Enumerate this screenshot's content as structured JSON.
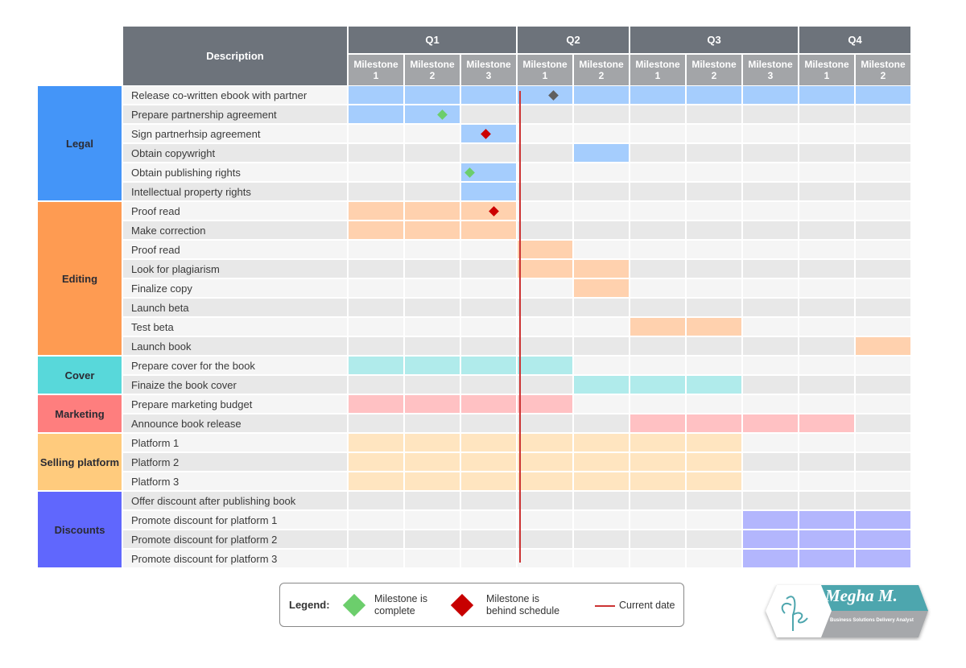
{
  "header": {
    "description_label": "Description",
    "quarters": [
      {
        "label": "Q1",
        "milestones": [
          "Milestone\n1",
          "Milestone\n2",
          "Milestone\n3"
        ]
      },
      {
        "label": "Q2",
        "milestones": [
          "Milestone\n1",
          "Milestone\n2"
        ]
      },
      {
        "label": "Q3",
        "milestones": [
          "Milestone\n1",
          "Milestone\n2",
          "Milestone\n3"
        ]
      },
      {
        "label": "Q4",
        "milestones": [
          "Milestone\n1",
          "Milestone\n2"
        ]
      }
    ]
  },
  "colors": {
    "row_light": "#f5f5f5",
    "row_dark": "#e8e8e8",
    "milestone_complete": "#6cce6c",
    "milestone_behind": "#cc0000",
    "milestone_neutral": "#5f5f5f",
    "current_date_line": "#cc3333"
  },
  "chart_data": {
    "type": "gantt",
    "title": "",
    "columns": [
      "Q1 Milestone 1",
      "Q1 Milestone 2",
      "Q1 Milestone 3",
      "Q2 Milestone 1",
      "Q2 Milestone 2",
      "Q3 Milestone 1",
      "Q3 Milestone 2",
      "Q3 Milestone 3",
      "Q4 Milestone 1",
      "Q4 Milestone 2"
    ],
    "current_date_column_fraction": 3.12,
    "categories": [
      {
        "name": "Legal",
        "color": "#4495f8",
        "bar_color": "#a5cdfd",
        "tasks": [
          {
            "name": "Release co-written ebook with partner",
            "start": 0,
            "end": 10,
            "milestone": {
              "column": 3,
              "position": 0.65,
              "status": "neutral"
            }
          },
          {
            "name": "Prepare partnership agreement",
            "start": 0,
            "end": 2,
            "milestone": {
              "column": 1,
              "position": 0.68,
              "status": "complete"
            }
          },
          {
            "name": "Sign partnerhsip agreement",
            "start": 2,
            "end": 3,
            "milestone": {
              "column": 2,
              "position": 0.45,
              "status": "behind"
            }
          },
          {
            "name": "Obtain copywright",
            "start": 4,
            "end": 5,
            "milestone": null
          },
          {
            "name": "Obtain publishing rights",
            "start": 2,
            "end": 3,
            "milestone": {
              "column": 2,
              "position": 0.15,
              "status": "complete"
            }
          },
          {
            "name": "Intellectual property rights",
            "start": 2,
            "end": 3,
            "milestone": null
          }
        ]
      },
      {
        "name": "Editing",
        "color": "#fe9b52",
        "bar_color": "#ffd1ae",
        "tasks": [
          {
            "name": "Proof read",
            "start": 0,
            "end": 3,
            "milestone": {
              "column": 2,
              "position": 0.6,
              "status": "behind"
            }
          },
          {
            "name": "Make correction",
            "start": 0,
            "end": 3,
            "milestone": null
          },
          {
            "name": "Proof read",
            "start": 3,
            "end": 4,
            "milestone": null
          },
          {
            "name": "Look for plagiarism",
            "start": 3,
            "end": 5,
            "milestone": null
          },
          {
            "name": "Finalize copy",
            "start": 4,
            "end": 5,
            "milestone": null
          },
          {
            "name": "Launch beta",
            "start": null,
            "end": null,
            "milestone": null
          },
          {
            "name": "Test beta",
            "start": 5,
            "end": 7,
            "milestone": null
          },
          {
            "name": "Launch book",
            "start": 9,
            "end": 10,
            "milestone": null
          }
        ]
      },
      {
        "name": "Cover",
        "color": "#58d8da",
        "bar_color": "#b0ebeb",
        "tasks": [
          {
            "name": "Prepare cover for the book",
            "start": 0,
            "end": 4,
            "milestone": null
          },
          {
            "name": "Finaize the book cover",
            "start": 4,
            "end": 7,
            "milestone": null
          }
        ]
      },
      {
        "name": "Marketing",
        "color": "#fe7e7e",
        "bar_color": "#ffc1c3",
        "tasks": [
          {
            "name": "Prepare marketing budget",
            "start": 0,
            "end": 4,
            "milestone": null
          },
          {
            "name": "Announce book release",
            "start": 5,
            "end": 9,
            "milestone": null
          }
        ]
      },
      {
        "name": "Selling platform",
        "color": "#ffcb7d",
        "bar_color": "#ffe5c0",
        "tasks": [
          {
            "name": "Platform 1",
            "start": 0,
            "end": 7,
            "milestone": null
          },
          {
            "name": "Platform 2",
            "start": 0,
            "end": 7,
            "milestone": null
          },
          {
            "name": "Platform 3",
            "start": 0,
            "end": 7,
            "milestone": null
          }
        ]
      },
      {
        "name": "Discounts",
        "color": "#6067fd",
        "bar_color": "#b3b6fd",
        "tasks": [
          {
            "name": "Offer discount after publishing book",
            "start": null,
            "end": null,
            "milestone": null
          },
          {
            "name": "Promote discount for platform 1",
            "start": 7,
            "end": 10,
            "milestone": null
          },
          {
            "name": "Promote discount for platform 2",
            "start": 7,
            "end": 10,
            "milestone": null
          },
          {
            "name": "Promote discount for platform 3",
            "start": 7,
            "end": 10,
            "milestone": null
          }
        ]
      }
    ]
  },
  "legend": {
    "title": "Legend:",
    "items": [
      {
        "label": "Milestone is complete",
        "line1": "Milestone is",
        "line2": "complete"
      },
      {
        "label": "Milestone is behind schedule",
        "line1": "Milestone is",
        "line2": "behind schedule"
      },
      {
        "label": "Current date"
      }
    ]
  },
  "logo": {
    "name": "Megha M.",
    "subtitle": "Business Solutions Delivery Analyst",
    "monogram": "cfe"
  }
}
